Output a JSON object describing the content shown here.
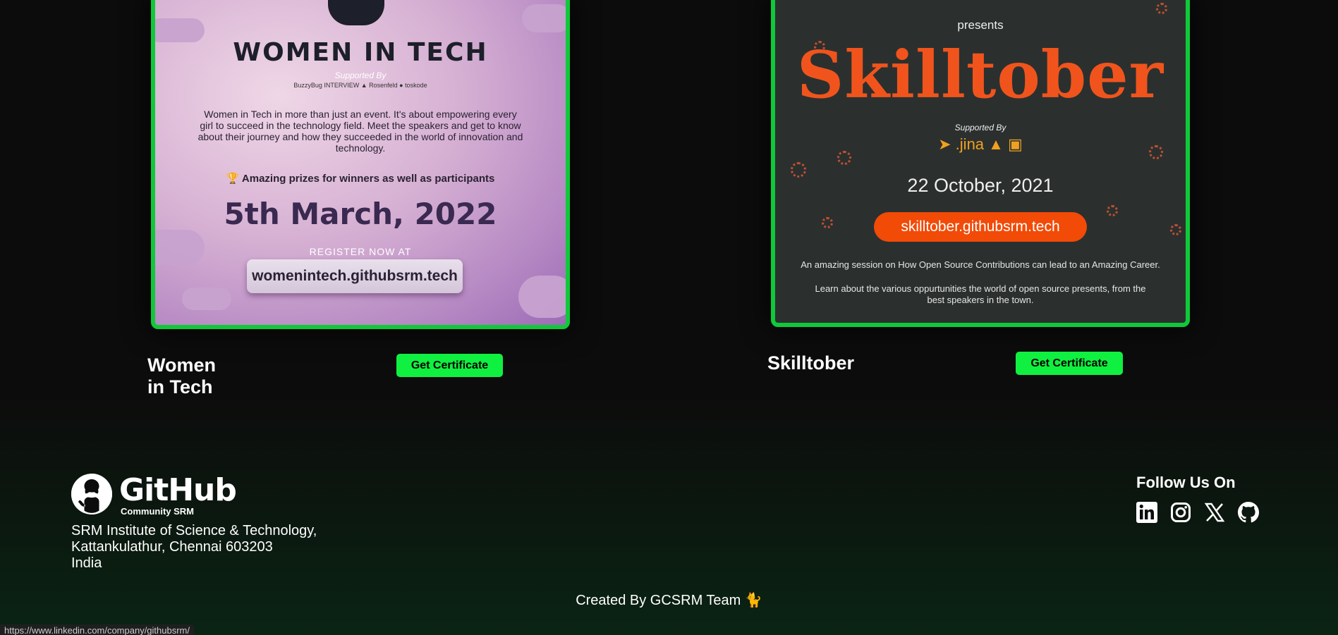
{
  "cards": [
    {
      "title": "Women in Tech",
      "button": "Get Certificate",
      "poster": {
        "heading": "WOMEN IN TECH",
        "supported": "Supported By",
        "sponsors": "BuzzyBug  INTERVIEW  ▲  Rosenfeld  ●  toskode",
        "description": "Women in Tech in more than just an event. It's about empowering every girl to succeed in the technology field. Meet the speakers and get to know about their journey and how they succeeded in the world of innovation and technology.",
        "prize": "🏆 Amazing prizes for winners as well as participants",
        "date": "5th March, 2022",
        "register": "REGISTER NOW AT",
        "link": "womenintech.githubsrm.tech"
      }
    },
    {
      "title": "Skilltober",
      "button": "Get Certificate",
      "poster": {
        "presents": "presents",
        "heading": "Skilltober",
        "supported": "Supported By",
        "sponsors": "➤ .jina ▲ ▣",
        "date": "22 October, 2021",
        "link": "skilltober.githubsrm.tech",
        "desc1": "An amazing session on How Open Source Contributions can lead to an Amazing Career.",
        "desc2": "Learn about the various oppurtunities the world of open source presents, from the best speakers in the town."
      }
    }
  ],
  "footer": {
    "logo_word": "GitHub",
    "logo_sub": "Community SRM",
    "address_line1": "SRM Institute of Science & Technology,",
    "address_line2": "Kattankulathur, Chennai 603203",
    "address_line3": "India",
    "follow": "Follow Us On",
    "social_icons": [
      "linkedin-icon",
      "instagram-icon",
      "x-icon",
      "github-icon"
    ],
    "credit": "Created By GCSRM Team 🐈"
  },
  "status_bar": {
    "url": "https://www.linkedin.com/company/githubsrm/"
  },
  "colors": {
    "accent_green": "#10f040",
    "border_green": "#10c93a",
    "skilltober_orange": "#f24a07"
  }
}
